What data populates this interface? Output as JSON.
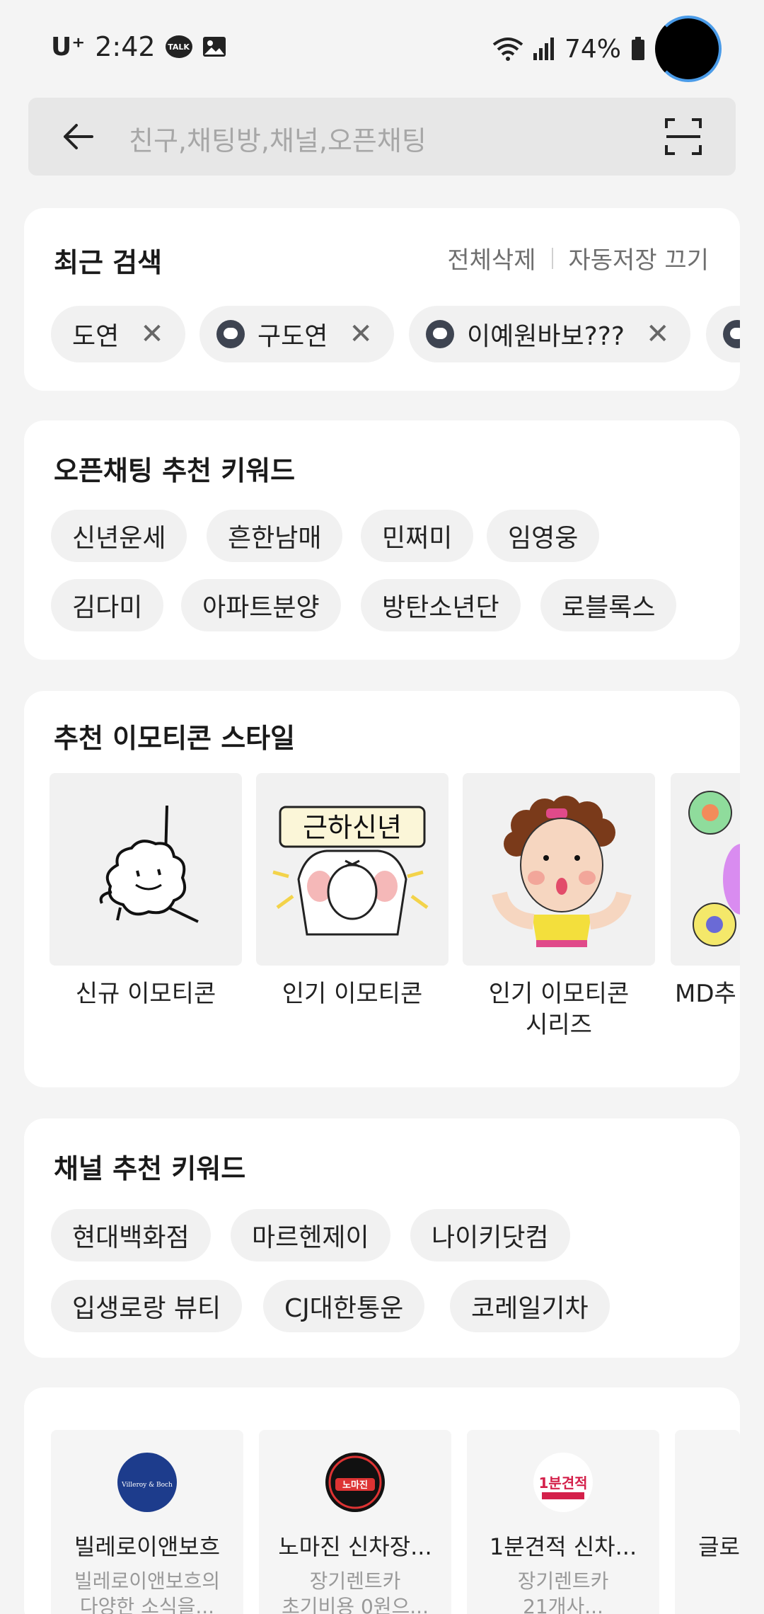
{
  "status_bar": {
    "carrier": "U⁺",
    "time": "2:42",
    "talk_badge": "TALK",
    "battery": "74%"
  },
  "search": {
    "placeholder": "친구,채팅방,채널,오픈채팅"
  },
  "recent": {
    "title": "최근 검색",
    "delete_all": "전체삭제",
    "auto_save_off": "자동저장 끄기",
    "items": [
      {
        "label": "도연",
        "has_icon": false
      },
      {
        "label": "구도연",
        "has_icon": true
      },
      {
        "label": "이예원바보???",
        "has_icon": true
      }
    ]
  },
  "openchat": {
    "title": "오픈채팅 추천 키워드",
    "row1": [
      "신년운세",
      "흔한남매",
      "민쩌미",
      "임영웅"
    ],
    "row2": [
      "김다미",
      "아파트분양",
      "방탄소년단",
      "로블록스"
    ]
  },
  "emoticon": {
    "title": "추천 이모티콘 스타일",
    "tiles": [
      {
        "label_line1": "신규 이모티콘",
        "label_line2": ""
      },
      {
        "label_line1": "인기 이모티콘",
        "label_line2": "",
        "banner": "근하신년"
      },
      {
        "label_line1": "인기 이모티콘",
        "label_line2": "시리즈"
      },
      {
        "label_line1": "MD추",
        "label_line2": ""
      }
    ]
  },
  "channel": {
    "title": "채널 추천 키워드",
    "row1": [
      "현대백화점",
      "마르헨제이",
      "나이키닷컴"
    ],
    "row2": [
      "입생로랑 뷰티",
      "CJ대한통운",
      "코레일기차"
    ]
  },
  "channels": [
    {
      "name": "빌레로이앤보흐",
      "desc1": "빌레로이앤보흐의",
      "desc2": "다양한 소식을...",
      "logo_text": "Villeroy & Boch"
    },
    {
      "name": "노마진 신차장...",
      "desc1": "장기렌트카",
      "desc2": "초기비용 0원으...",
      "logo_text": "노마진"
    },
    {
      "name": "1분견적 신차...",
      "desc1": "장기렌트카",
      "desc2": "21개사...",
      "logo_text": "1분견적"
    },
    {
      "name": "글로",
      "desc1": "",
      "desc2": "",
      "logo_text": ""
    }
  ],
  "colors": {
    "background": "#f4f4f4",
    "card": "#ffffff",
    "chip": "#f1f1f1",
    "avatar_ring": "#4a9be8"
  }
}
